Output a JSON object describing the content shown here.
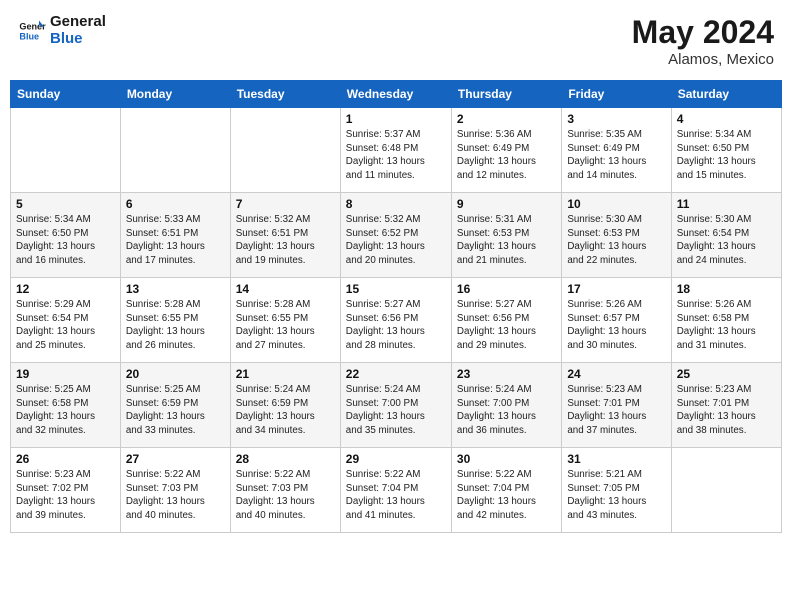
{
  "header": {
    "logo_line1": "General",
    "logo_line2": "Blue",
    "month_year": "May 2024",
    "location": "Alamos, Mexico"
  },
  "weekdays": [
    "Sunday",
    "Monday",
    "Tuesday",
    "Wednesday",
    "Thursday",
    "Friday",
    "Saturday"
  ],
  "weeks": [
    [
      {
        "day": "",
        "info": ""
      },
      {
        "day": "",
        "info": ""
      },
      {
        "day": "",
        "info": ""
      },
      {
        "day": "1",
        "info": "Sunrise: 5:37 AM\nSunset: 6:48 PM\nDaylight: 13 hours\nand 11 minutes."
      },
      {
        "day": "2",
        "info": "Sunrise: 5:36 AM\nSunset: 6:49 PM\nDaylight: 13 hours\nand 12 minutes."
      },
      {
        "day": "3",
        "info": "Sunrise: 5:35 AM\nSunset: 6:49 PM\nDaylight: 13 hours\nand 14 minutes."
      },
      {
        "day": "4",
        "info": "Sunrise: 5:34 AM\nSunset: 6:50 PM\nDaylight: 13 hours\nand 15 minutes."
      }
    ],
    [
      {
        "day": "5",
        "info": "Sunrise: 5:34 AM\nSunset: 6:50 PM\nDaylight: 13 hours\nand 16 minutes."
      },
      {
        "day": "6",
        "info": "Sunrise: 5:33 AM\nSunset: 6:51 PM\nDaylight: 13 hours\nand 17 minutes."
      },
      {
        "day": "7",
        "info": "Sunrise: 5:32 AM\nSunset: 6:51 PM\nDaylight: 13 hours\nand 19 minutes."
      },
      {
        "day": "8",
        "info": "Sunrise: 5:32 AM\nSunset: 6:52 PM\nDaylight: 13 hours\nand 20 minutes."
      },
      {
        "day": "9",
        "info": "Sunrise: 5:31 AM\nSunset: 6:53 PM\nDaylight: 13 hours\nand 21 minutes."
      },
      {
        "day": "10",
        "info": "Sunrise: 5:30 AM\nSunset: 6:53 PM\nDaylight: 13 hours\nand 22 minutes."
      },
      {
        "day": "11",
        "info": "Sunrise: 5:30 AM\nSunset: 6:54 PM\nDaylight: 13 hours\nand 24 minutes."
      }
    ],
    [
      {
        "day": "12",
        "info": "Sunrise: 5:29 AM\nSunset: 6:54 PM\nDaylight: 13 hours\nand 25 minutes."
      },
      {
        "day": "13",
        "info": "Sunrise: 5:28 AM\nSunset: 6:55 PM\nDaylight: 13 hours\nand 26 minutes."
      },
      {
        "day": "14",
        "info": "Sunrise: 5:28 AM\nSunset: 6:55 PM\nDaylight: 13 hours\nand 27 minutes."
      },
      {
        "day": "15",
        "info": "Sunrise: 5:27 AM\nSunset: 6:56 PM\nDaylight: 13 hours\nand 28 minutes."
      },
      {
        "day": "16",
        "info": "Sunrise: 5:27 AM\nSunset: 6:56 PM\nDaylight: 13 hours\nand 29 minutes."
      },
      {
        "day": "17",
        "info": "Sunrise: 5:26 AM\nSunset: 6:57 PM\nDaylight: 13 hours\nand 30 minutes."
      },
      {
        "day": "18",
        "info": "Sunrise: 5:26 AM\nSunset: 6:58 PM\nDaylight: 13 hours\nand 31 minutes."
      }
    ],
    [
      {
        "day": "19",
        "info": "Sunrise: 5:25 AM\nSunset: 6:58 PM\nDaylight: 13 hours\nand 32 minutes."
      },
      {
        "day": "20",
        "info": "Sunrise: 5:25 AM\nSunset: 6:59 PM\nDaylight: 13 hours\nand 33 minutes."
      },
      {
        "day": "21",
        "info": "Sunrise: 5:24 AM\nSunset: 6:59 PM\nDaylight: 13 hours\nand 34 minutes."
      },
      {
        "day": "22",
        "info": "Sunrise: 5:24 AM\nSunset: 7:00 PM\nDaylight: 13 hours\nand 35 minutes."
      },
      {
        "day": "23",
        "info": "Sunrise: 5:24 AM\nSunset: 7:00 PM\nDaylight: 13 hours\nand 36 minutes."
      },
      {
        "day": "24",
        "info": "Sunrise: 5:23 AM\nSunset: 7:01 PM\nDaylight: 13 hours\nand 37 minutes."
      },
      {
        "day": "25",
        "info": "Sunrise: 5:23 AM\nSunset: 7:01 PM\nDaylight: 13 hours\nand 38 minutes."
      }
    ],
    [
      {
        "day": "26",
        "info": "Sunrise: 5:23 AM\nSunset: 7:02 PM\nDaylight: 13 hours\nand 39 minutes."
      },
      {
        "day": "27",
        "info": "Sunrise: 5:22 AM\nSunset: 7:03 PM\nDaylight: 13 hours\nand 40 minutes."
      },
      {
        "day": "28",
        "info": "Sunrise: 5:22 AM\nSunset: 7:03 PM\nDaylight: 13 hours\nand 40 minutes."
      },
      {
        "day": "29",
        "info": "Sunrise: 5:22 AM\nSunset: 7:04 PM\nDaylight: 13 hours\nand 41 minutes."
      },
      {
        "day": "30",
        "info": "Sunrise: 5:22 AM\nSunset: 7:04 PM\nDaylight: 13 hours\nand 42 minutes."
      },
      {
        "day": "31",
        "info": "Sunrise: 5:21 AM\nSunset: 7:05 PM\nDaylight: 13 hours\nand 43 minutes."
      },
      {
        "day": "",
        "info": ""
      }
    ]
  ]
}
